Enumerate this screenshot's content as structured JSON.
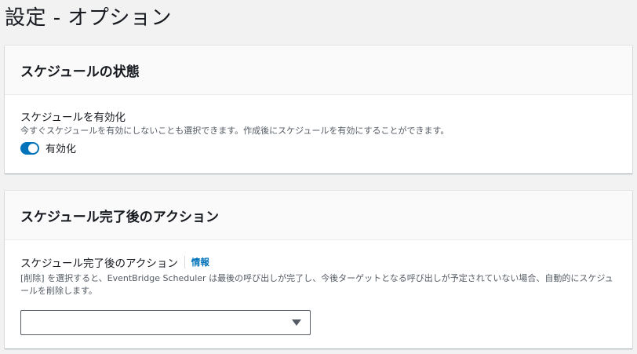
{
  "page": {
    "title": "設定 - オプション"
  },
  "schedule_state": {
    "heading": "スケジュールの状態",
    "field_label": "スケジュールを有効化",
    "description": "今すぐスケジュールを有効にしないことも選択できます。作成後にスケジュールを有効にすることができます。",
    "toggle_label": "有効化",
    "toggle_on": true
  },
  "post_completion": {
    "heading": "スケジュール完了後のアクション",
    "field_label": "スケジュール完了後のアクション",
    "info_link": "情報",
    "description": "[削除] を選択すると、EventBridge Scheduler は最後の呼び出しが完了し、今後ターゲットとなる呼び出しが予定されていない場合、自動的にスケジュールを削除します。",
    "select_value": ""
  },
  "colors": {
    "accent": "#0073bb",
    "background": "#f2f2f2"
  }
}
